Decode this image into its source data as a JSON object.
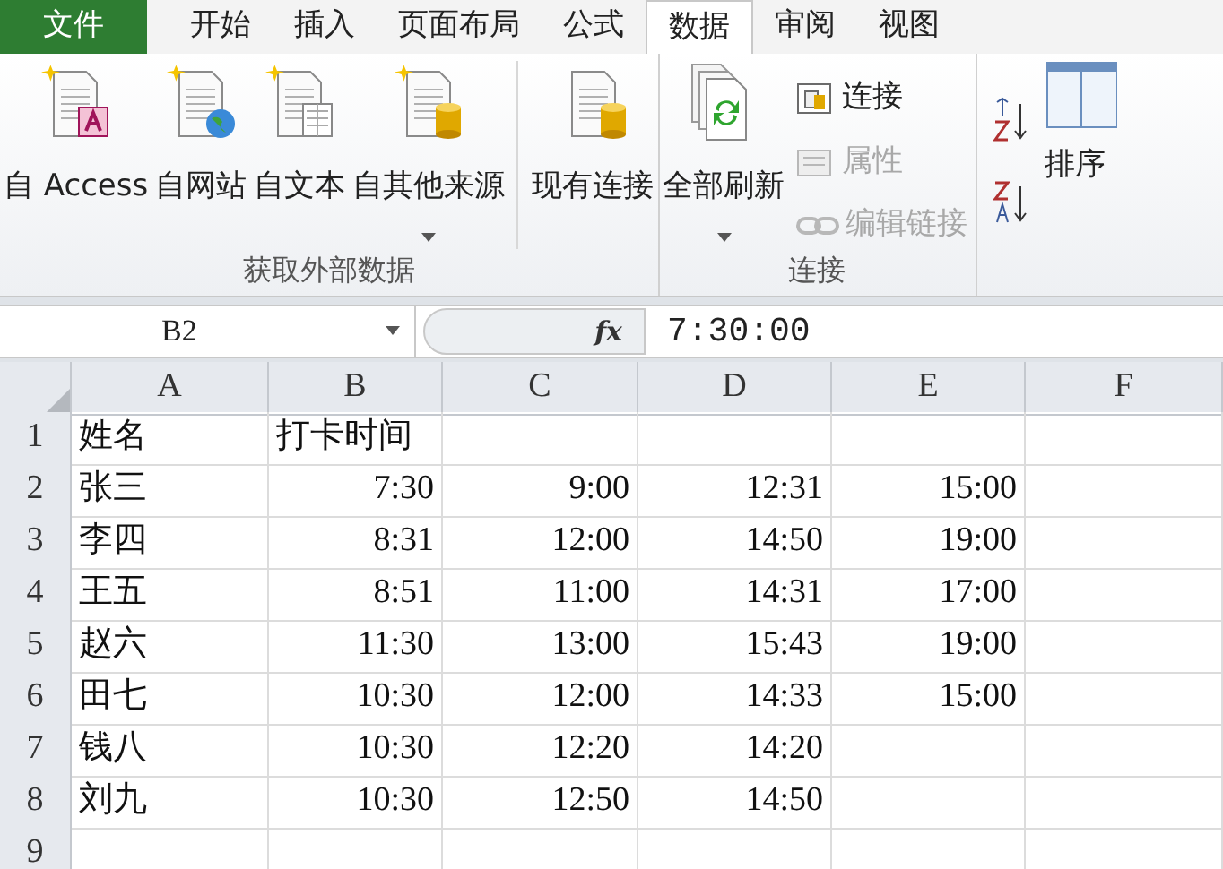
{
  "tabs": [
    {
      "label": "文件",
      "kind": "file",
      "selected": false
    },
    {
      "label": "开始",
      "kind": "tab",
      "selected": false
    },
    {
      "label": "插入",
      "kind": "tab",
      "selected": false
    },
    {
      "label": "页面布局",
      "kind": "tab",
      "selected": false
    },
    {
      "label": "公式",
      "kind": "tab",
      "selected": false
    },
    {
      "label": "数据",
      "kind": "tab",
      "selected": true
    },
    {
      "label": "审阅",
      "kind": "tab",
      "selected": false
    },
    {
      "label": "视图",
      "kind": "tab",
      "selected": false
    }
  ],
  "ribbon": {
    "groups": [
      {
        "label": "获取外部数据",
        "buttons": [
          {
            "label": "自 Access",
            "kind": "access",
            "dropdown": false
          },
          {
            "label": "自网站",
            "kind": "web",
            "dropdown": false
          },
          {
            "label": "自文本",
            "kind": "text",
            "dropdown": false
          },
          {
            "label": "自其他来源",
            "kind": "database",
            "dropdown": true
          },
          {
            "label": "现有连接",
            "kind": "existing",
            "dropdown": false
          }
        ]
      },
      {
        "label": "连接",
        "buttons": [
          {
            "label": "全部刷新",
            "kind": "refresh",
            "dropdown": true
          }
        ],
        "small_buttons": [
          {
            "label": "连接",
            "kind": "connections",
            "disabled": false
          },
          {
            "label": "属性",
            "kind": "properties",
            "disabled": true
          },
          {
            "label": "编辑链接",
            "kind": "links",
            "disabled": true
          }
        ]
      }
    ],
    "sort": {
      "label": "排序"
    }
  },
  "formula_bar": {
    "name_box": "B2",
    "fx": "fx",
    "value": "7:30:00"
  },
  "sheet": {
    "columns": [
      "A",
      "B",
      "C",
      "D",
      "E",
      "F"
    ],
    "rows": [
      {
        "header": "1",
        "cells": [
          "姓名",
          "打卡时间",
          "",
          "",
          "",
          ""
        ]
      },
      {
        "header": "2",
        "cells": [
          "张三",
          "7:30",
          "9:00",
          "12:31",
          "15:00",
          ""
        ]
      },
      {
        "header": "3",
        "cells": [
          "李四",
          "8:31",
          "12:00",
          "14:50",
          "19:00",
          ""
        ]
      },
      {
        "header": "4",
        "cells": [
          "王五",
          "8:51",
          "11:00",
          "14:31",
          "17:00",
          ""
        ]
      },
      {
        "header": "5",
        "cells": [
          "赵六",
          "11:30",
          "13:00",
          "15:43",
          "19:00",
          ""
        ]
      },
      {
        "header": "6",
        "cells": [
          "田七",
          "10:30",
          "12:00",
          "14:33",
          "15:00",
          ""
        ]
      },
      {
        "header": "7",
        "cells": [
          "钱八",
          "10:30",
          "12:20",
          "14:20",
          "",
          ""
        ]
      },
      {
        "header": "8",
        "cells": [
          "刘九",
          "10:30",
          "12:50",
          "14:50",
          "",
          ""
        ]
      },
      {
        "header": "9",
        "cells": [
          "",
          "",
          "",
          "",
          "",
          ""
        ]
      }
    ]
  }
}
